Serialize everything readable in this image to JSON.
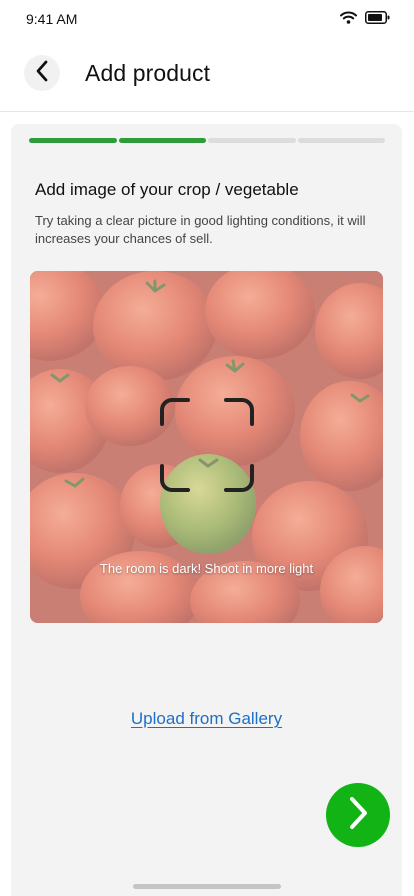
{
  "status_bar": {
    "time": "9:41 AM",
    "icons": [
      "wifi-icon",
      "battery-icon"
    ]
  },
  "header": {
    "back_icon": "chevron-left-icon",
    "title": "Add product"
  },
  "progress": {
    "total_steps": 4,
    "completed_steps": 2
  },
  "step": {
    "title": "Add image of your crop / vegetable",
    "description": "Try taking a clear picture in good lighting conditions, it will increases your chances of sell."
  },
  "camera": {
    "hint": "The room is dark! Shoot in more light",
    "frame_icon": "scan-frame-icon"
  },
  "upload": {
    "label": "Upload from Gallery"
  },
  "next": {
    "icon": "chevron-right-icon"
  },
  "colors": {
    "accent_green": "#11b315",
    "progress_done": "#2e9c3a",
    "link_blue": "#1f6fc4"
  }
}
